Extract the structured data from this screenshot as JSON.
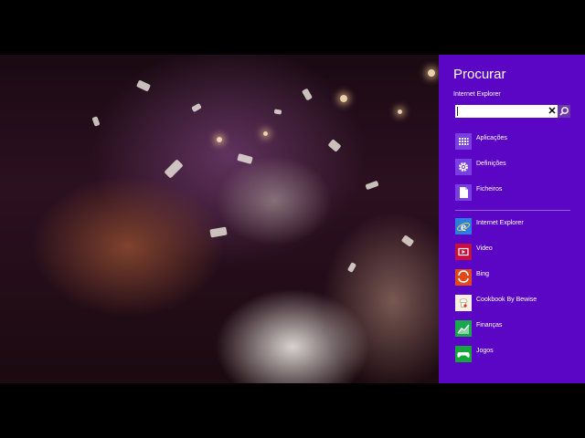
{
  "search_pane": {
    "title": "Procurar",
    "scope": "Internet Explorer",
    "query": "",
    "categories": [
      {
        "label": "Aplicações",
        "icon": "apps-grid-icon",
        "color": "#7a3fe0"
      },
      {
        "label": "Definições",
        "icon": "gear-icon",
        "color": "#7a3fe0"
      },
      {
        "label": "Ficheiros",
        "icon": "file-icon",
        "color": "#7a3fe0"
      }
    ],
    "apps": [
      {
        "label": "Internet Explorer",
        "icon": "internet-explorer-icon",
        "color": "#2a7ee0"
      },
      {
        "label": "Video",
        "icon": "video-icon",
        "color": "#c8103e"
      },
      {
        "label": "Bing",
        "icon": "bing-icon",
        "color": "#e04a1a"
      },
      {
        "label": "Cookbook By Bewise",
        "icon": "cookbook-icon",
        "color": "#f4f0e8"
      },
      {
        "label": "Finanças",
        "icon": "finance-chart-icon",
        "color": "#1aa84c"
      },
      {
        "label": "Jogos",
        "icon": "game-controller-icon",
        "color": "#16a43c"
      }
    ]
  },
  "colors": {
    "charm_background": "#5b06c4"
  }
}
